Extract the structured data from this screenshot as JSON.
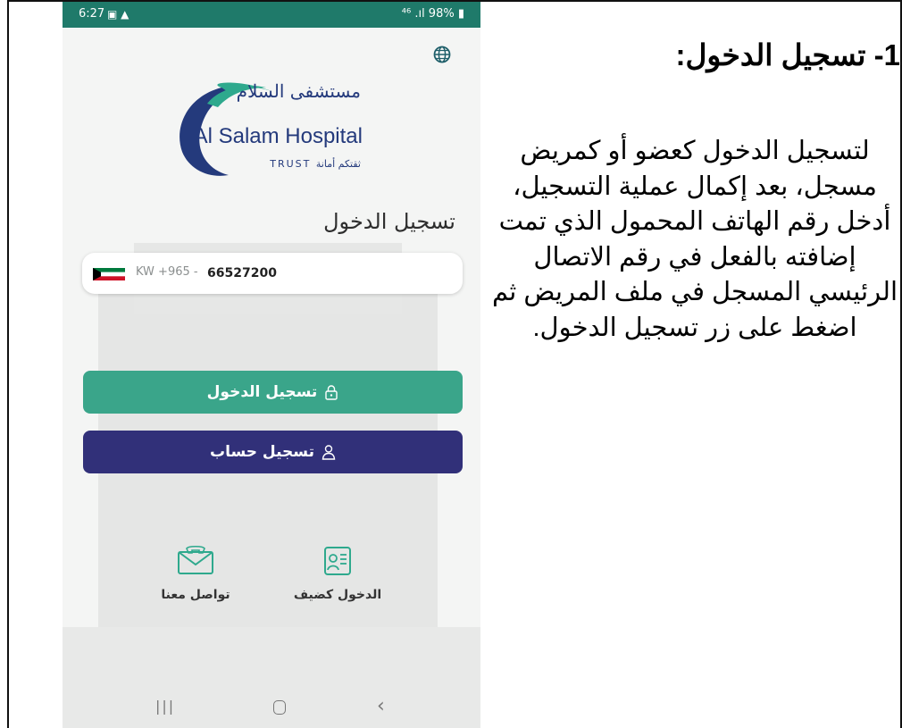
{
  "phone": {
    "status_time": "6:27",
    "status_left_icons": "▣ ▲",
    "status_right": "⁴⁶ .ıl 98% ▮",
    "logo": {
      "arabic": "مستشفى السلام",
      "english": "Al Salam Hospital",
      "tagline": "TRUST ثقتكم أمانة"
    },
    "login_heading": "تسجيل الدخول",
    "phone_field": {
      "country_code": "KW +965 -",
      "value": "66527200"
    },
    "buttons": {
      "login": "تسجيل الدخول",
      "register": "تسجيل حساب"
    },
    "quick_actions": {
      "guest": "الدخول كضيف",
      "contact": "تواصل معنا"
    },
    "icons": {
      "globe": "globe-icon",
      "flag": "kuwait-flag-icon",
      "lock": "lock-icon",
      "user": "user-icon",
      "guest": "id-card-icon",
      "contact": "phone-envelope-icon"
    },
    "colors": {
      "status_bar": "#1f7a6a",
      "login_button": "#3aa58a",
      "register_button": "#313079",
      "logo_blue": "#243a7c",
      "logo_green": "#2ea98d"
    }
  },
  "instructions": {
    "title": "1- تسجيل الدخول:",
    "body": "لتسجيل الدخول كعضو أو كمريض مسجل، بعد إكمال عملية التسجيل، أدخل رقم الهاتف المحمول الذي تمت إضافته بالفعل في رقم الاتصال الرئيسي المسجل في ملف المريض ثم اضغط على زر تسجيل الدخول."
  }
}
